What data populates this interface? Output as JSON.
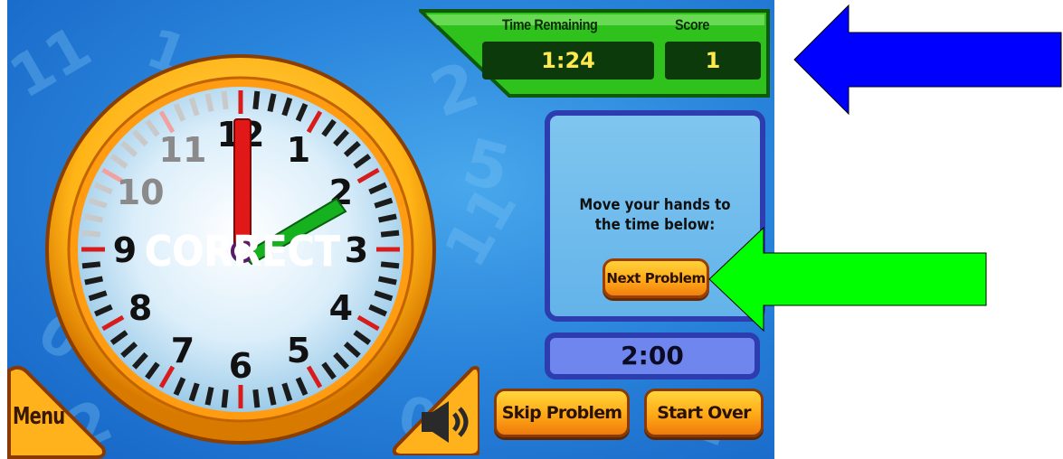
{
  "hud": {
    "time_remaining_label": "Time Remaining",
    "score_label": "Score",
    "time_remaining": "1:24",
    "score": "1"
  },
  "clock": {
    "numbers": [
      "12",
      "1",
      "2",
      "3",
      "4",
      "5",
      "6",
      "7",
      "8",
      "9",
      "10",
      "11"
    ],
    "hour_hand_points_to": 2,
    "minute_hand_points_to": 0,
    "feedback": "CORRECT"
  },
  "instruction": {
    "text": "Move your hands to the time below:",
    "next_button": "Next Problem",
    "target_time": "2:00"
  },
  "buttons": {
    "menu": "Menu",
    "sound_icon": "speaker-icon",
    "skip": "Skip Problem",
    "start_over": "Start Over"
  },
  "annotations": {
    "blue_arrow_color": "#0000ff",
    "green_arrow_color": "#00ff00"
  },
  "colors": {
    "background_blue": "#2a85dc",
    "hud_green": "#2ec01e",
    "panel_border": "#2d3cae",
    "button_orange": "#ffa516",
    "clock_rim": "#ffb81c"
  }
}
